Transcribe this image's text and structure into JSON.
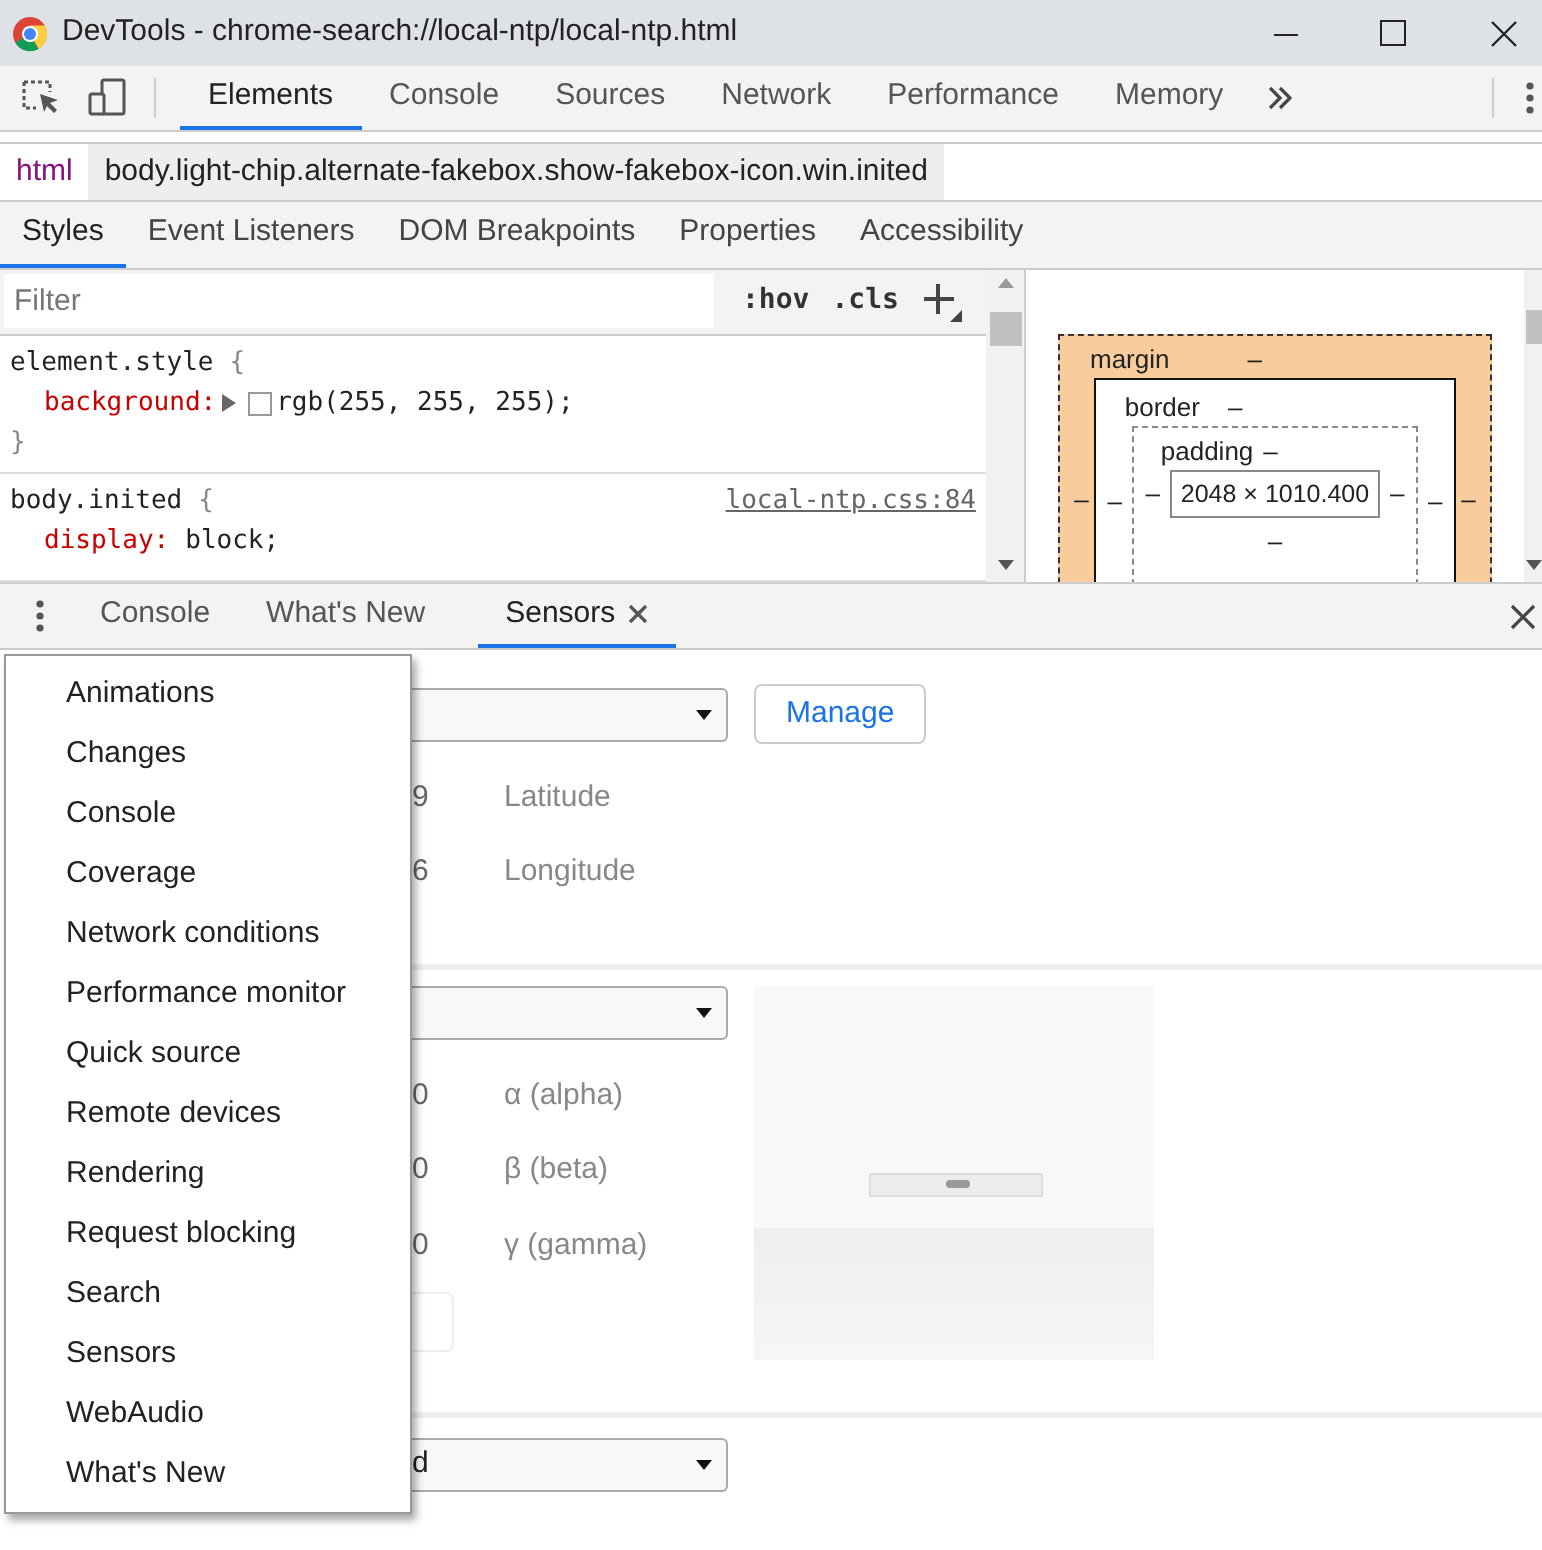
{
  "window": {
    "title": "DevTools - chrome-search://local-ntp/local-ntp.html"
  },
  "toolbar": {
    "tabs": [
      {
        "label": "Elements",
        "selected": true
      },
      {
        "label": "Console",
        "selected": false
      },
      {
        "label": "Sources",
        "selected": false
      },
      {
        "label": "Network",
        "selected": false
      },
      {
        "label": "Performance",
        "selected": false
      },
      {
        "label": "Memory",
        "selected": false
      }
    ]
  },
  "breadcrumbs": [
    {
      "text": "html",
      "selected": false
    },
    {
      "text": "body.light-chip.alternate-fakebox.show-fakebox-icon.win.inited",
      "selected": true
    }
  ],
  "subtabs": [
    {
      "label": "Styles",
      "selected": true
    },
    {
      "label": "Event Listeners",
      "selected": false
    },
    {
      "label": "DOM Breakpoints",
      "selected": false
    },
    {
      "label": "Properties",
      "selected": false
    },
    {
      "label": "Accessibility",
      "selected": false
    }
  ],
  "styles": {
    "filter": {
      "placeholder": "Filter"
    },
    "hov": ":hov",
    "cls": ".cls",
    "rules": [
      {
        "selector": "element.style",
        "open": "{",
        "close": "}",
        "properties": [
          {
            "name": "background:",
            "value": "rgb(255, 255, 255);",
            "kind": "color",
            "color": "#ffffff"
          }
        ]
      },
      {
        "selector": "body.inited",
        "open": "{",
        "source": "local-ntp.css:84",
        "properties": [
          {
            "name": "display:",
            "value": "block;",
            "kind": "plain"
          }
        ]
      }
    ]
  },
  "box_model": {
    "margin": {
      "label": "margin",
      "top": "–",
      "left": "–",
      "right": "–"
    },
    "border": {
      "label": "border",
      "top": "–",
      "left": "–",
      "right": "–"
    },
    "padding": {
      "label": "padding",
      "top": "–",
      "left": "–",
      "right": "–",
      "bottom": "–"
    },
    "content": "2048 × 1010.400"
  },
  "drawer": {
    "tabs": [
      {
        "label": "Console",
        "selected": false,
        "closable": false
      },
      {
        "label": "What's New",
        "selected": false,
        "closable": false
      },
      {
        "label": "Sensors",
        "selected": true,
        "closable": true
      }
    ],
    "menu": {
      "items": [
        "Animations",
        "Changes",
        "Console",
        "Coverage",
        "Network conditions",
        "Performance monitor",
        "Quick source",
        "Remote devices",
        "Rendering",
        "Request blocking",
        "Search",
        "Sensors",
        "WebAudio",
        "What's New"
      ]
    },
    "sensors": {
      "location": {
        "manage": "Manage",
        "fields": [
          {
            "value": "9",
            "label": "Latitude"
          },
          {
            "value": "6",
            "label": "Longitude"
          }
        ]
      },
      "orientation": {
        "fields": [
          {
            "value": "0",
            "label": "α (alpha)"
          },
          {
            "value": "0",
            "label": "β (beta)"
          },
          {
            "value": "0",
            "label": "γ (gamma)"
          }
        ]
      },
      "touch": {
        "select_value": "d"
      }
    }
  }
}
